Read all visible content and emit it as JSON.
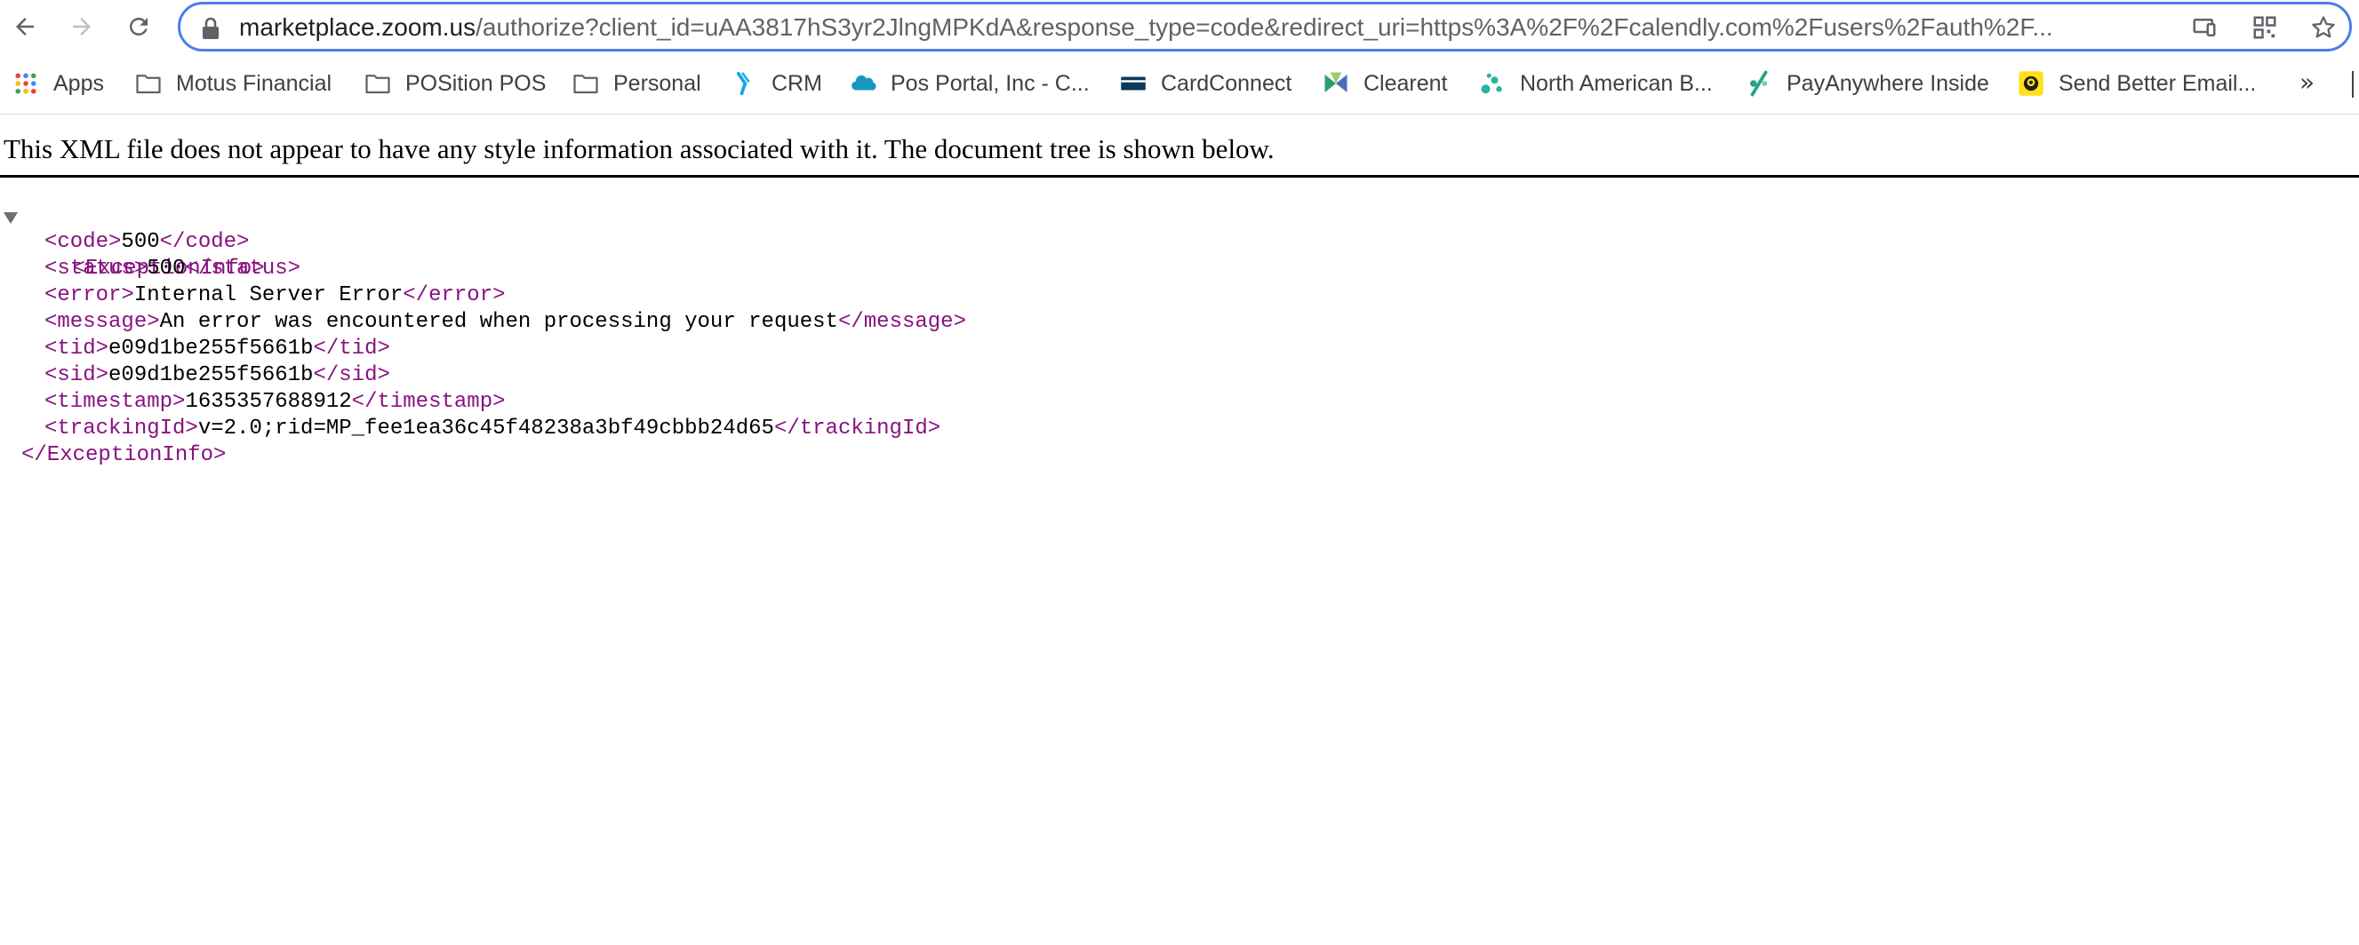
{
  "browser": {
    "url_host": "marketplace.zoom.us",
    "url_path": "/authorize?client_id=uAA3817hS3yr2JlngMPKdA&response_type=code&redirect_uri=https%3A%2F%2Fcalendly.com%2Fusers%2Fauth%2F..."
  },
  "bookmarks": [
    {
      "label": "Apps",
      "icon": "apps-grid-icon"
    },
    {
      "label": "Motus Financial",
      "icon": "folder-icon"
    },
    {
      "label": "POSition POS",
      "icon": "folder-icon"
    },
    {
      "label": "Personal",
      "icon": "folder-icon"
    },
    {
      "label": "CRM",
      "icon": "crm-logo-icon"
    },
    {
      "label": "Pos Portal, Inc - C...",
      "icon": "salesforce-cloud-icon"
    },
    {
      "label": "CardConnect",
      "icon": "cardconnect-card-icon"
    },
    {
      "label": "Clearent",
      "icon": "clearent-logo-icon"
    },
    {
      "label": "North American B...",
      "icon": "north-american-logo-icon"
    },
    {
      "label": "PayAnywhere Inside",
      "icon": "payanywhere-logo-icon"
    },
    {
      "label": "Send Better Email...",
      "icon": "mailchimp-icon"
    }
  ],
  "bookmarks_overflow": "»",
  "notice": "This XML file does not appear to have any style information associated with it. The document tree is shown below.",
  "xml": {
    "root_open": "<ExceptionInfo>",
    "root_close": "</ExceptionInfo>",
    "elements": [
      {
        "open": "<code>",
        "value": "500",
        "close": "</code>"
      },
      {
        "open": "<status>",
        "value": "500",
        "close": "</status>"
      },
      {
        "open": "<error>",
        "value": "Internal Server Error",
        "close": "</error>"
      },
      {
        "open": "<message>",
        "value": "An error was encountered when processing your request",
        "close": "</message>"
      },
      {
        "open": "<tid>",
        "value": "e09d1be255f5661b",
        "close": "</tid>"
      },
      {
        "open": "<sid>",
        "value": "e09d1be255f5661b",
        "close": "</sid>"
      },
      {
        "open": "<timestamp>",
        "value": "1635357688912",
        "close": "</timestamp>"
      },
      {
        "open": "<trackingId>",
        "value": "v=2.0;rid=MP_fee1ea36c45f48238a3bf49cbbb24d65",
        "close": "</trackingId>"
      }
    ]
  },
  "colors": {
    "tag": "#881280",
    "omnibox_border": "#4b7fe6",
    "text": "#000000"
  }
}
